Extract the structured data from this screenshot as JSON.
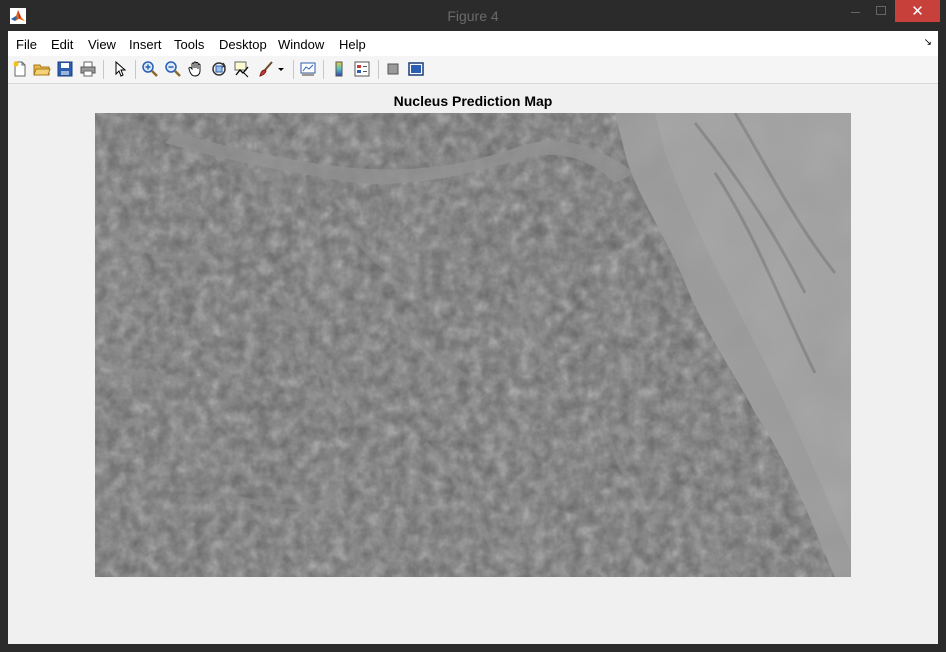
{
  "window": {
    "title": "Figure 4",
    "close_glyph": "✕"
  },
  "menu": {
    "items": [
      "File",
      "Edit",
      "View",
      "Insert",
      "Tools",
      "Desktop",
      "Window",
      "Help"
    ],
    "dock_arrow": "↘"
  },
  "toolbar": {
    "buttons": [
      {
        "name": "new-figure",
        "icon": "new-document-icon"
      },
      {
        "name": "open-file",
        "icon": "folder-open-icon"
      },
      {
        "name": "save-figure",
        "icon": "save-disk-icon"
      },
      {
        "name": "print-figure",
        "icon": "printer-icon"
      },
      {
        "name": "edit-plot",
        "icon": "pointer-arrow-icon"
      },
      {
        "name": "zoom-in",
        "icon": "zoom-in-icon"
      },
      {
        "name": "zoom-out",
        "icon": "zoom-out-icon"
      },
      {
        "name": "pan",
        "icon": "hand-pan-icon"
      },
      {
        "name": "rotate-3d",
        "icon": "rotate-3d-icon"
      },
      {
        "name": "data-cursor",
        "icon": "data-cursor-icon"
      },
      {
        "name": "brush",
        "icon": "brush-icon"
      },
      {
        "name": "link-plot",
        "icon": "link-plot-icon"
      },
      {
        "name": "insert-colorbar",
        "icon": "colorbar-icon"
      },
      {
        "name": "insert-legend",
        "icon": "legend-icon"
      },
      {
        "name": "hide-plot-tools",
        "icon": "hide-tools-icon"
      },
      {
        "name": "show-plot-tools",
        "icon": "show-tools-icon"
      }
    ]
  },
  "figure": {
    "title": "Nucleus Prediction Map",
    "image_description_colors": {
      "tissue_dark": "#5a5a5a",
      "tissue_mid": "#6e6e6e",
      "stroma_light": "#9a9a9a"
    }
  },
  "colors": {
    "close_button": "#c7403a",
    "titlebar": "#2b2b2b",
    "client_background": "#f0f0f0"
  }
}
